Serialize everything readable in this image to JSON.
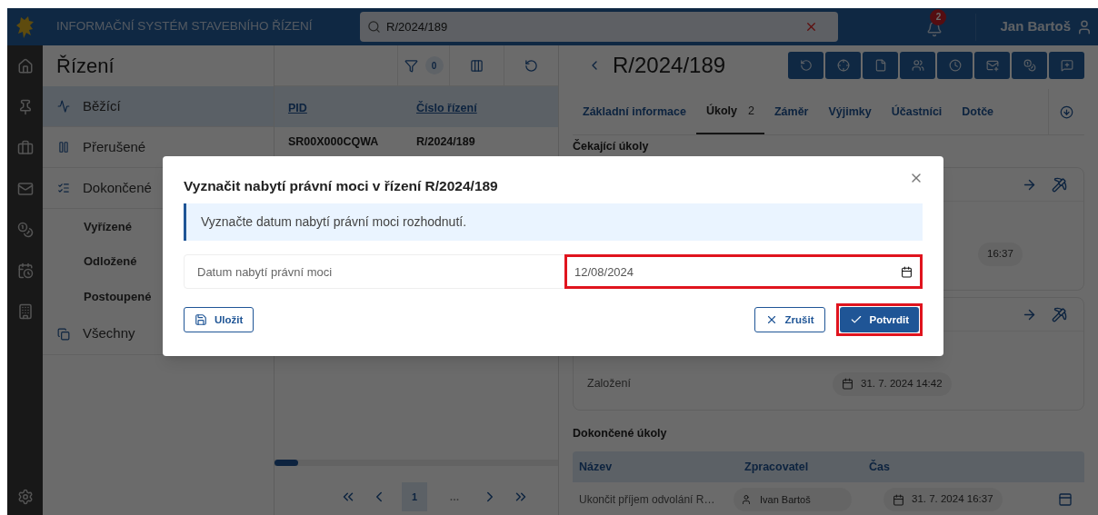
{
  "header": {
    "title": "INFORMAČNÍ SYSTÉM STAVEBNÍHO ŘÍZENÍ",
    "search": {
      "value": "R/2024/189"
    },
    "notifications": "2",
    "user": "Jan Bartoš"
  },
  "sidebar": {
    "title": "Řízení",
    "items": [
      {
        "label": "Běžící",
        "kind": "running",
        "selected": true
      },
      {
        "label": "Přerušené",
        "kind": "paused",
        "selected": false
      },
      {
        "label": "Dokončené",
        "kind": "done",
        "selected": false,
        "children": [
          {
            "label": "Vyřízené",
            "selected": false
          },
          {
            "label": "Odložené",
            "selected": false
          },
          {
            "label": "Postoupené",
            "selected": false
          }
        ]
      },
      {
        "label": "Všechny",
        "kind": "all",
        "selected": false
      }
    ]
  },
  "table": {
    "filter_count": "0",
    "columns": [
      "PID",
      "Číslo řízení"
    ],
    "rows": [
      [
        "SR00X000CQWA",
        "R/2024/189"
      ]
    ],
    "pages": [
      {
        "label": "1",
        "selected": true
      },
      {
        "label": "…",
        "selected": false
      }
    ]
  },
  "detail": {
    "title": "R/2024/189",
    "tabs": [
      {
        "label": "Základní informace",
        "selected": false
      },
      {
        "label": "Úkoly",
        "count": "2",
        "selected": true
      },
      {
        "label": "Záměr",
        "selected": false
      },
      {
        "label": "Výjimky",
        "selected": false
      },
      {
        "label": "Účastníci",
        "selected": false
      },
      {
        "label": "Dotče",
        "selected": false
      }
    ],
    "pending_title": "Čekající úkoly",
    "cards": [
      {
        "rows": [
          {
            "time": "16:37"
          }
        ]
      },
      {
        "rows": [
          {
            "label": "Založení",
            "time": "31. 7. 2024 14:42"
          }
        ]
      }
    ],
    "completed_title": "Dokončené úkoly",
    "completed": {
      "columns": [
        "Název",
        "Zpracovatel",
        "Čas"
      ],
      "rows": [
        {
          "name": "Ukončit příjem odvolání R…",
          "user": "Ivan Bartoš",
          "time": "31. 7. 2024 16:37"
        }
      ]
    }
  },
  "dialog": {
    "title": "Vyznačit nabytí právní moci v řízení R/2024/189",
    "info": "Vyznačte datum nabytí právní moci rozhodnutí.",
    "field": {
      "label": "Datum nabytí právní moci",
      "value": "12/08/2024",
      "highlighted": true
    },
    "buttons": [
      {
        "label": "Uložit",
        "kind": "save",
        "highlighted": false
      },
      {
        "label": "Zrušit",
        "kind": "cancel",
        "highlighted": false
      },
      {
        "label": "Potvrdit",
        "kind": "confirm",
        "highlighted": true
      }
    ]
  }
}
